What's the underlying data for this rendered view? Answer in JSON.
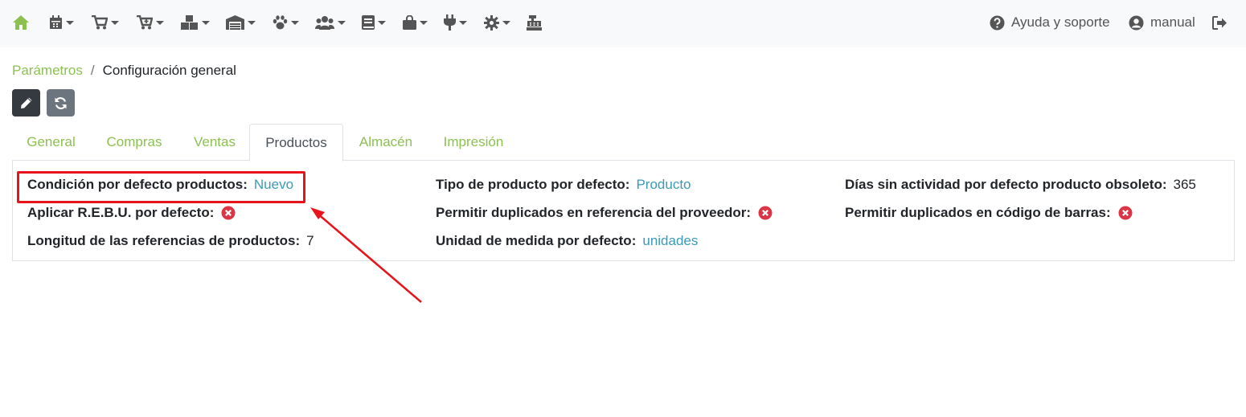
{
  "navbar": {
    "icons": [
      "home-icon",
      "calendar-icon",
      "cart-icon",
      "cart-plus-icon",
      "boxes-icon",
      "warehouse-icon",
      "paw-icon",
      "users-icon",
      "book-icon",
      "shopping-bag-icon",
      "plug-icon",
      "cog-icon",
      "cash-register-icon"
    ],
    "help_label": "Ayuda y soporte",
    "user_label": "manual"
  },
  "breadcrumb": {
    "parent": "Parámetros",
    "separator": "/",
    "current": "Configuración general"
  },
  "tabs": [
    {
      "label": "General",
      "active": false
    },
    {
      "label": "Compras",
      "active": false
    },
    {
      "label": "Ventas",
      "active": false
    },
    {
      "label": "Productos",
      "active": true
    },
    {
      "label": "Almacén",
      "active": false
    },
    {
      "label": "Impresión",
      "active": false
    }
  ],
  "fields": {
    "condicion": {
      "label": "Condición por defecto productos:",
      "value": "Nuevo"
    },
    "rebu": {
      "label": "Aplicar R.E.B.U. por defecto:"
    },
    "longitud": {
      "label": "Longitud de las referencias de productos:",
      "value": "7"
    },
    "tipo": {
      "label": "Tipo de producto por defecto:",
      "value": "Producto"
    },
    "duplicados_proveedor": {
      "label": "Permitir duplicados en referencia del proveedor:"
    },
    "unidad": {
      "label": "Unidad de medida por defecto:",
      "value": "unidades"
    },
    "dias": {
      "label": "Días sin actividad por defecto producto obsoleto:",
      "value": "365"
    },
    "duplicados_barras": {
      "label": "Permitir duplicados en código de barras:"
    }
  },
  "colors": {
    "accent_green": "#8cc152",
    "link_blue": "#3a9ab8",
    "danger_red": "#dc3545",
    "annotation_red": "#e8141b"
  }
}
